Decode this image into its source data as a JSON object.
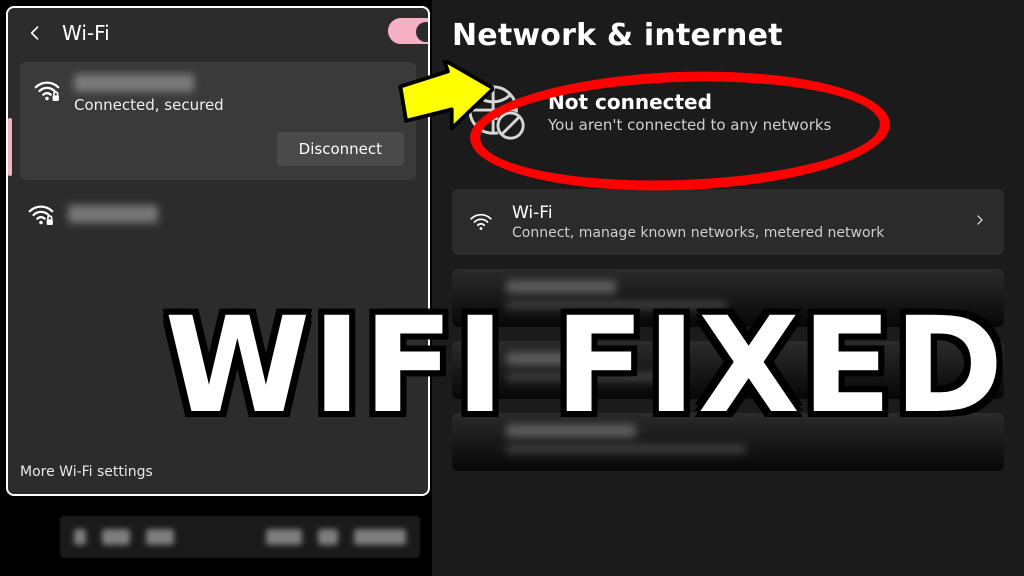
{
  "left_panel": {
    "title": "Wi-Fi",
    "toggle_on": true,
    "connected_network": {
      "status": "Connected, secured",
      "disconnect_label": "Disconnect"
    },
    "more_settings_label": "More Wi-Fi settings"
  },
  "right_panel": {
    "title": "Network & internet",
    "status_title": "Not connected",
    "status_subtitle": "You aren't connected to any networks",
    "wifi_row": {
      "title": "Wi-Fi",
      "subtitle": "Connect, manage known networks, metered network"
    }
  },
  "overlay": {
    "headline": "WIFI FIXED"
  }
}
